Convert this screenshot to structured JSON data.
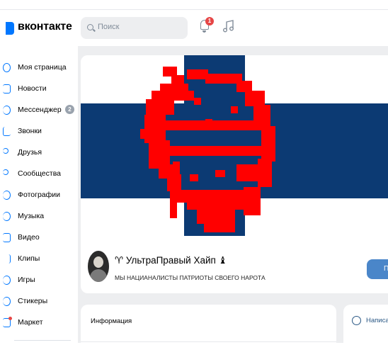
{
  "header": {
    "logo_text": "вконтакте",
    "search_placeholder": "Поиск",
    "notifications_count": "1"
  },
  "sidebar": {
    "items": [
      {
        "label": "Моя страница",
        "icon": "user-circle-icon"
      },
      {
        "label": "Новости",
        "icon": "news-icon"
      },
      {
        "label": "Мессенджер",
        "icon": "chat-icon",
        "badge": "2"
      },
      {
        "label": "Звонки",
        "icon": "phone-icon"
      },
      {
        "label": "Друзья",
        "icon": "friends-icon"
      },
      {
        "label": "Сообщества",
        "icon": "groups-icon"
      },
      {
        "label": "Фотографии",
        "icon": "photo-icon"
      },
      {
        "label": "Музыка",
        "icon": "music-icon"
      },
      {
        "label": "Видео",
        "icon": "video-icon"
      },
      {
        "label": "Клипы",
        "icon": "clips-icon"
      },
      {
        "label": "Игры",
        "icon": "games-icon"
      },
      {
        "label": "Стикеры",
        "icon": "stickers-icon"
      },
      {
        "label": "Маркет",
        "icon": "market-icon"
      }
    ]
  },
  "profile": {
    "name": "♈ УльтраПравый Хайп ♝",
    "status": "МЫ НАЦИАНАЛИСТЫ ПАТРИОТЫ СВОЕГО НАРОТА",
    "action_button": "П"
  },
  "info": {
    "title": "Информация"
  },
  "write": {
    "label": "Написа"
  },
  "colors": {
    "accent": "#0077ff",
    "flag_blue": "#0c3a73",
    "paint_red": "#ff0000"
  }
}
